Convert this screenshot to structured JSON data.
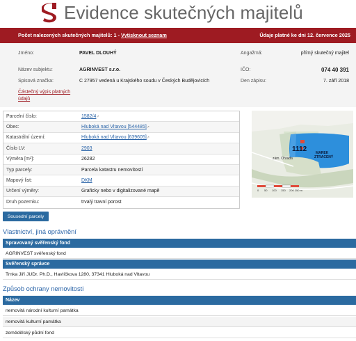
{
  "header": {
    "title": "Evidence skutečných majitelů"
  },
  "redbar": {
    "count_label": "Počet nalezených skutečných majitelů: 1",
    "separator": "-",
    "print_link": "Vytisknout seznam",
    "validity": "Údaje platné ke dni 12. července 2025"
  },
  "owner": {
    "name_label": "Jméno:",
    "name_value": "PAVEL DLOUHÝ",
    "entity_label": "Název subjektu:",
    "entity_value": "AGRINVEST s.r.o.",
    "file_label": "Spisová značka:",
    "file_value": "C 27957 vedená u Krajského soudu v Českých Budějovicích",
    "partial_link_1": "Částečný výpis platných",
    "partial_link_2": "údajů",
    "engagement_label": "Angažmá:",
    "engagement_value": "přímý skutečný majitel",
    "ico_label": "IČO:",
    "ico_value": "074 40 391",
    "entry_label": "Den zápisu:",
    "entry_value": "7. září 2018"
  },
  "parcel": {
    "rows": [
      {
        "label": "Parcelní číslo:",
        "value": "1582/4",
        "link": true,
        "ext": true
      },
      {
        "label": "Obec:",
        "value": "Hluboká nad Vltavou [544485]",
        "link": true,
        "ext": true
      },
      {
        "label": "Katastrální území:",
        "value": "Hluboká nad Vltavou [639605]",
        "link": true,
        "ext": true
      },
      {
        "label": "Číslo LV:",
        "value": "2903",
        "link": true,
        "ext": false
      },
      {
        "label": "Výměra [m²]:",
        "value": "26282",
        "link": false,
        "ext": false
      },
      {
        "label": "Typ parcely:",
        "value": "Parcela katastru nemovitostí",
        "link": false,
        "ext": false
      },
      {
        "label": "Mapový list:",
        "value": "DKM",
        "link": true,
        "ext": false
      },
      {
        "label": "Určení výměry:",
        "value": "Graficky nebo v digitalizované mapě",
        "link": false,
        "ext": false
      },
      {
        "label": "Druh pozemku:",
        "value": "trvalý travní porost",
        "link": false,
        "ext": false
      }
    ]
  },
  "map": {
    "place_label": "zám. Ohrada",
    "water_label_1": "MAREK",
    "water_label_2": "ZTRACENÝ",
    "scale_labels": [
      "0",
      "50",
      "100",
      "150",
      "200 250 m"
    ]
  },
  "neighbors_button": "Sousední parcely",
  "ownership": {
    "title": "Vlastnictví, jiná oprávnění",
    "managed_header": "Spravovaný svěřenský fond",
    "managed_value": "AGRINVEST svěřenský fond",
    "trustee_header": "Svěřenský správce",
    "trustee_value": "Trnka Jiří JUDr. Ph.D., Havlíčkova 1280, 37341 Hluboká nad Vltavou"
  },
  "protection": {
    "title": "Způsob ochrany nemovitosti",
    "header": "Název",
    "items": [
      "nemovitá národní kulturní památka",
      "nemovitá kulturní památka",
      "zemědělský půdní fond"
    ]
  },
  "colors": {
    "brand_red": "#9e1b22",
    "accent_blue": "#2b6aa0",
    "link_blue": "#2a64a8"
  }
}
